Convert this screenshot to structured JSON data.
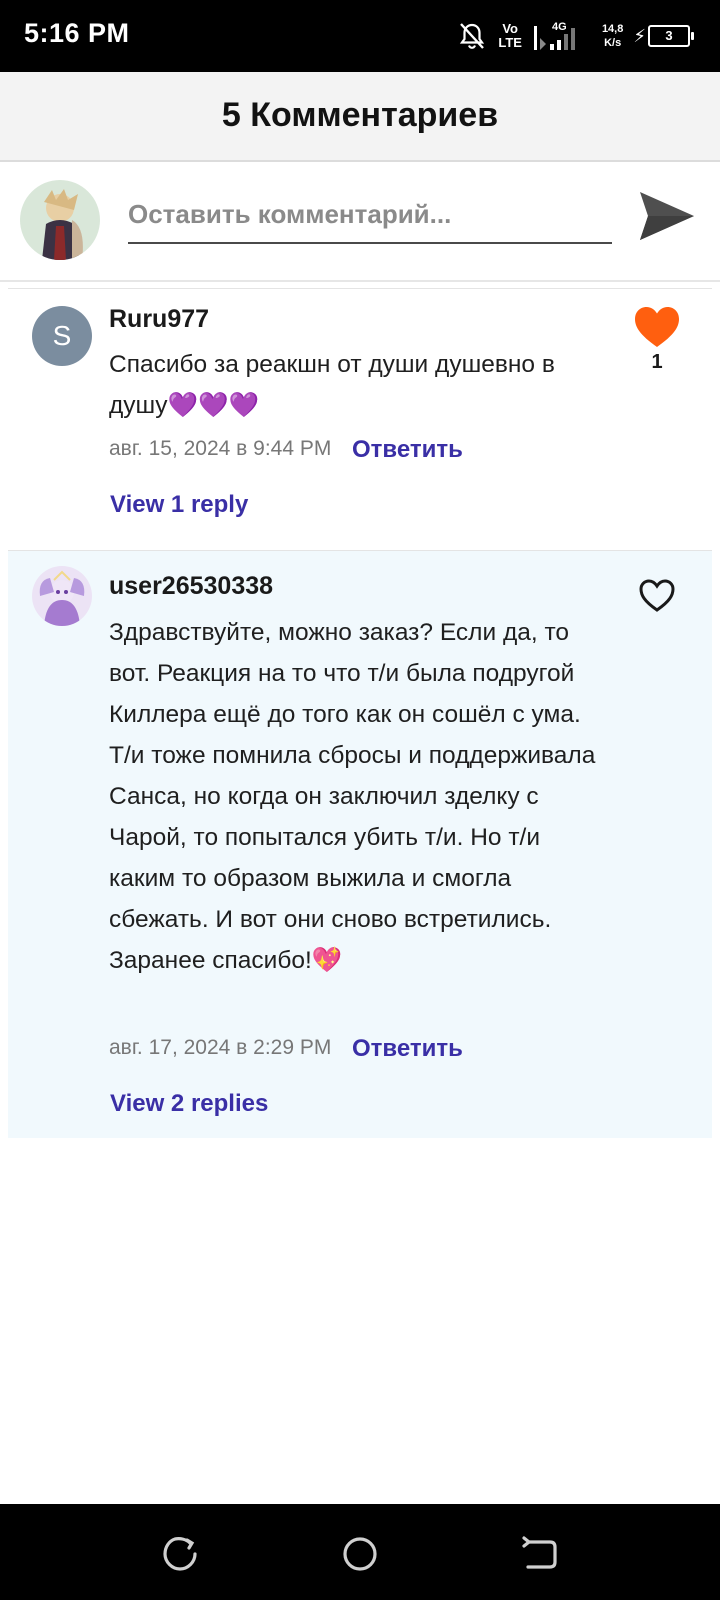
{
  "status_bar": {
    "time": "5:16 PM",
    "volte_top": "Vo",
    "volte_bottom": "LTE",
    "net_type": "4G",
    "speed_value": "14,8",
    "speed_unit": "K/s",
    "battery_level": "3"
  },
  "header": {
    "title": "5 Комментариев"
  },
  "composer": {
    "placeholder": "Оставить комментарий..."
  },
  "comments": [
    {
      "avatar_letter": "S",
      "username": "Ruru977",
      "text": "Спасибо за реакшн от души душевно в душу💜💜💜",
      "date": "авг. 15, 2024 в 9:44 PM",
      "reply_label": "Ответить",
      "view_replies": "View 1 reply",
      "like_count": "1",
      "liked": true
    },
    {
      "username": "user26530338",
      "text": "Здравствуйте, можно заказ? Если да, то вот. Реакция на то что т/и была подругой Киллера ещё до того как он сошёл с ума. Т/и тоже помнила сбросы и поддерживала Санса, но когда он заключил зделку с Чарой, то попытался убить т/и. Но т/и каким то образом выжила и смогла сбежать. И вот они сново встретились.\nЗаранее спасибо!💖",
      "date": "авг. 17, 2024 в 2:29 PM",
      "reply_label": "Ответить",
      "view_replies": "View 2 replies",
      "liked": false
    }
  ],
  "colors": {
    "accent": "#3a2fa6",
    "like": "#ff5f0f",
    "highlight_bg": "#f1f9fd",
    "header_bg": "#f3f3f3"
  },
  "icons": [
    "bell-off-icon",
    "signal-icon",
    "send-icon",
    "heart-filled-icon",
    "heart-outline-icon",
    "recent-apps-icon",
    "home-icon",
    "back-icon"
  ]
}
